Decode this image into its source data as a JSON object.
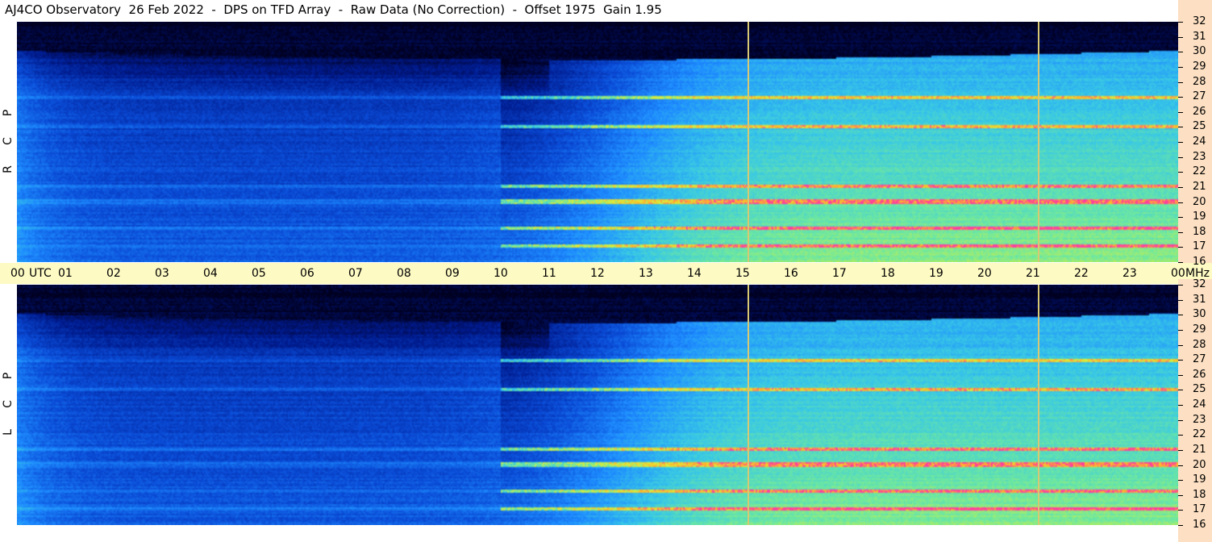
{
  "title": "AJ4CO Observatory  26 Feb 2022  -  DPS on TFD Array  -  Raw Data (No Correction)  -  Offset 1975  Gain 1.95",
  "panels": [
    {
      "name": "RCP",
      "letters": [
        "R",
        "C",
        "P"
      ]
    },
    {
      "name": "LCP",
      "letters": [
        "L",
        "C",
        "P"
      ]
    }
  ],
  "time_axis": {
    "ticks": [
      "00",
      "01",
      "02",
      "03",
      "04",
      "05",
      "06",
      "07",
      "08",
      "09",
      "10",
      "11",
      "12",
      "13",
      "14",
      "15",
      "16",
      "17",
      "18",
      "19",
      "20",
      "21",
      "22",
      "23",
      "00"
    ],
    "utc_label": "UTC",
    "mhz_label": "MHz"
  },
  "freq_axis": {
    "ticks": [
      "32",
      "31",
      "30",
      "29",
      "28",
      "27",
      "26",
      "25",
      "24",
      "23",
      "22",
      "21",
      "20",
      "19",
      "18",
      "17",
      "16"
    ]
  },
  "colors": {
    "background": "#ffffff",
    "time_axis_bg": "#fdfac3",
    "freq_axis_bg": "#fde0c3",
    "gap_line": "#d8c873"
  },
  "chart_data": {
    "type": "heatmap",
    "title": "AJ4CO Observatory  26 Feb 2022  -  DPS on TFD Array  -  Raw Data (No Correction)  -  Offset 1975  Gain 1.95",
    "x": {
      "label": "UTC",
      "range": [
        0,
        24
      ],
      "unit": "hours"
    },
    "y": {
      "label": "MHz",
      "range": [
        16,
        32
      ]
    },
    "series": [
      {
        "name": "RCP"
      },
      {
        "name": "LCP"
      }
    ],
    "data_gaps_utc": [
      15.1,
      21.1
    ],
    "persistent_bands_mhz": [
      27.0,
      25.0,
      21.0,
      20.0,
      18.2,
      17.0
    ],
    "colormap": [
      "#000020",
      "#001a8c",
      "#0a4bd6",
      "#1e8cff",
      "#38c8e6",
      "#6ee8a0",
      "#d8f03c",
      "#ffb428",
      "#ff3ca0"
    ]
  }
}
